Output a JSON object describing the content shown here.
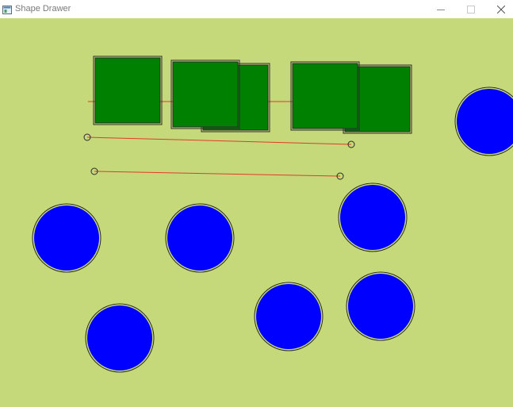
{
  "window": {
    "title": "Shape Drawer",
    "icon": "app-window-icon"
  },
  "controls": {
    "minimize_icon": "minimize-icon",
    "maximize_icon": "maximize-icon",
    "close_icon": "close-icon"
  },
  "canvas": {
    "background": "#c5d97a",
    "square_fill": "#008000",
    "circle_fill": "#0000ff",
    "outline": "#2a2a2a",
    "line_color": "#e03c28"
  }
}
